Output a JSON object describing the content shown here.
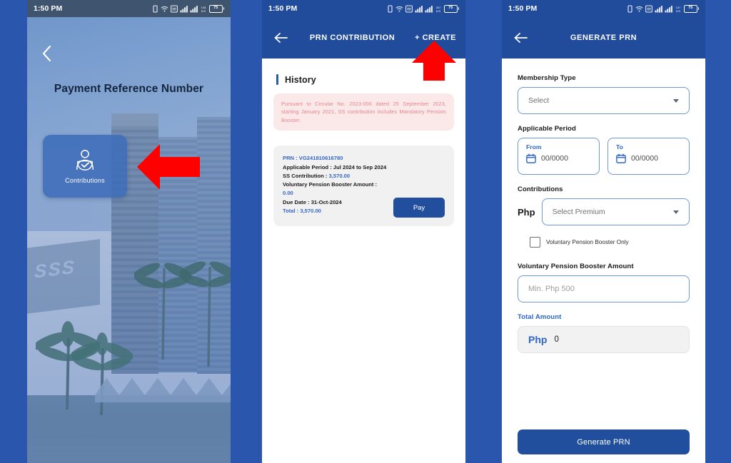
{
  "meta": {
    "accent_blue": "#224e9e",
    "link_blue": "#3767c4",
    "arrow_red": "#ff0000",
    "notice_pink_bg": "#fbe9ea",
    "notice_pink_text": "#e8868c"
  },
  "status_bar": {
    "time": "1:50 PM",
    "battery_level": "75",
    "icons": [
      "vibrate-icon",
      "wifi-icon",
      "data-saver-icon",
      "signal-sim1-icon",
      "signal-sim2-icon",
      "network-speed-icon",
      "battery-icon"
    ]
  },
  "panel1": {
    "screen_name": "Payment Reference Number",
    "back_icon": "chevron-left-icon",
    "title": "Payment Reference Number",
    "background_photo_text": "SSS",
    "tile": {
      "icon": "contributions-person-check-icon",
      "label": "Contributions"
    },
    "annotation_arrow": "left-arrow-annotation"
  },
  "panel2": {
    "appbar": {
      "back_icon": "arrow-left-icon",
      "title": "PRN CONTRIBUTION",
      "action_label": "+ CREATE"
    },
    "section": {
      "title": "History"
    },
    "notice": "Pursuant to Circular No. 2023-006 dated 25 September 2023, starting January 2021, SS contribution includes Mandatory Pension Booster.",
    "prn_card": {
      "prn_label": "PRN :",
      "prn_value": "VG241810616780",
      "applicable_period_label": "Applicable Period :",
      "applicable_period_value": "Jul 2024 to Sep 2024",
      "ss_contribution_label": "SS Contribution :",
      "ss_contribution_value": "3,570.00",
      "vpb_label": "Voluntary Pension Booster Amount :",
      "vpb_value": "0.00",
      "due_date_label": "Due Date :",
      "due_date_value": "31-Oct-2024",
      "total_label": "Total :",
      "total_value": "3,570.00",
      "pay_button": "Pay"
    },
    "annotation_arrow": "up-arrow-annotation"
  },
  "panel3": {
    "appbar": {
      "back_icon": "arrow-left-icon",
      "title": "GENERATE PRN"
    },
    "membership_type": {
      "label": "Membership Type",
      "value": "Select",
      "caret_icon": "chevron-down-icon"
    },
    "applicable_period": {
      "label": "Applicable Period",
      "from": {
        "caption": "From",
        "value": "00/0000",
        "icon": "calendar-icon"
      },
      "to": {
        "caption": "To",
        "value": "00/0000",
        "icon": "calendar-icon"
      }
    },
    "contributions": {
      "label": "Contributions",
      "currency": "Php",
      "premium_value": "Select Premium",
      "caret_icon": "chevron-down-icon",
      "checkbox_label": "Voluntary Pension Booster Only",
      "checkbox_checked": false
    },
    "vpb_amount": {
      "label": "Voluntary Pension Booster Amount",
      "placeholder": "Min. Php 500",
      "value": ""
    },
    "total_amount": {
      "label": "Total Amount",
      "currency": "Php",
      "value": "0"
    },
    "generate_button": "Generate PRN"
  }
}
